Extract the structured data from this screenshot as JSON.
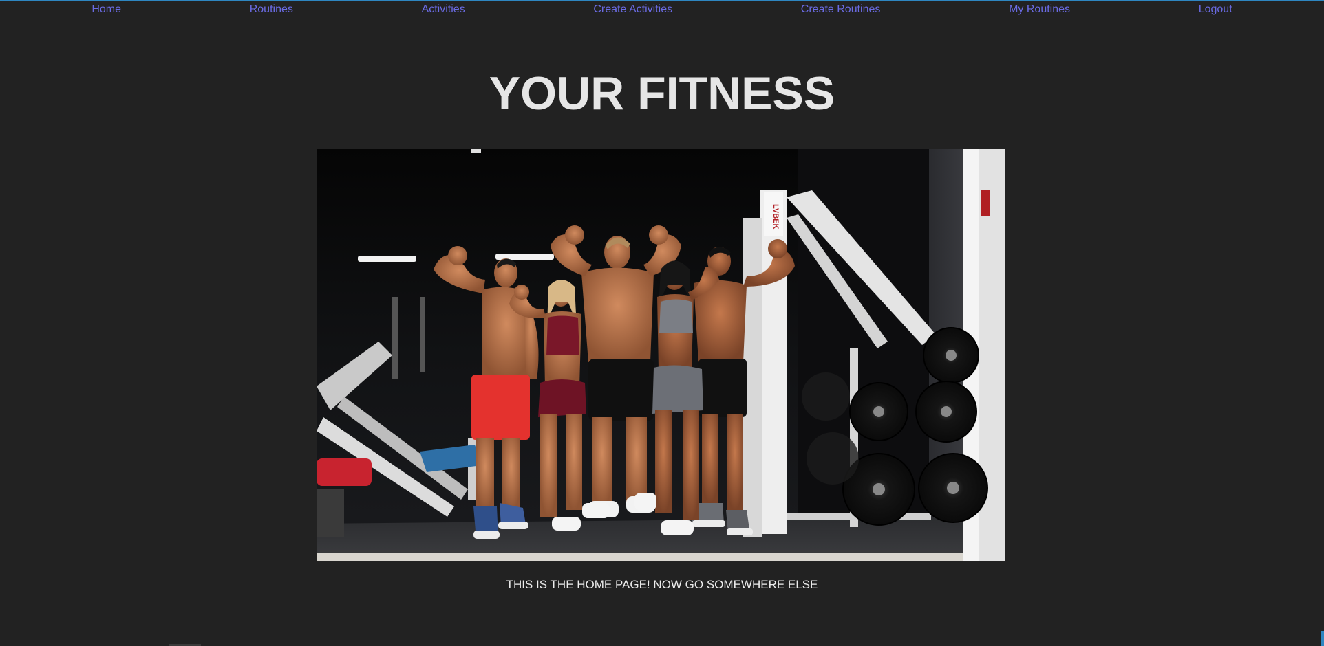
{
  "nav": {
    "items": [
      {
        "label": "Home"
      },
      {
        "label": "Routines"
      },
      {
        "label": "Activities"
      },
      {
        "label": "Create Activities"
      },
      {
        "label": "Create Routines"
      },
      {
        "label": "My Routines"
      },
      {
        "label": "Logout"
      }
    ]
  },
  "header": {
    "title": "YOUR FITNESS"
  },
  "hero": {
    "logo_text": "LVBEK"
  },
  "main": {
    "message": "THIS IS THE HOME PAGE! NOW GO SOMEWHERE ELSE"
  },
  "colors": {
    "background": "#222222",
    "nav_link": "#6a6be3",
    "title": "#e6e6e6",
    "text": "#ededed"
  }
}
